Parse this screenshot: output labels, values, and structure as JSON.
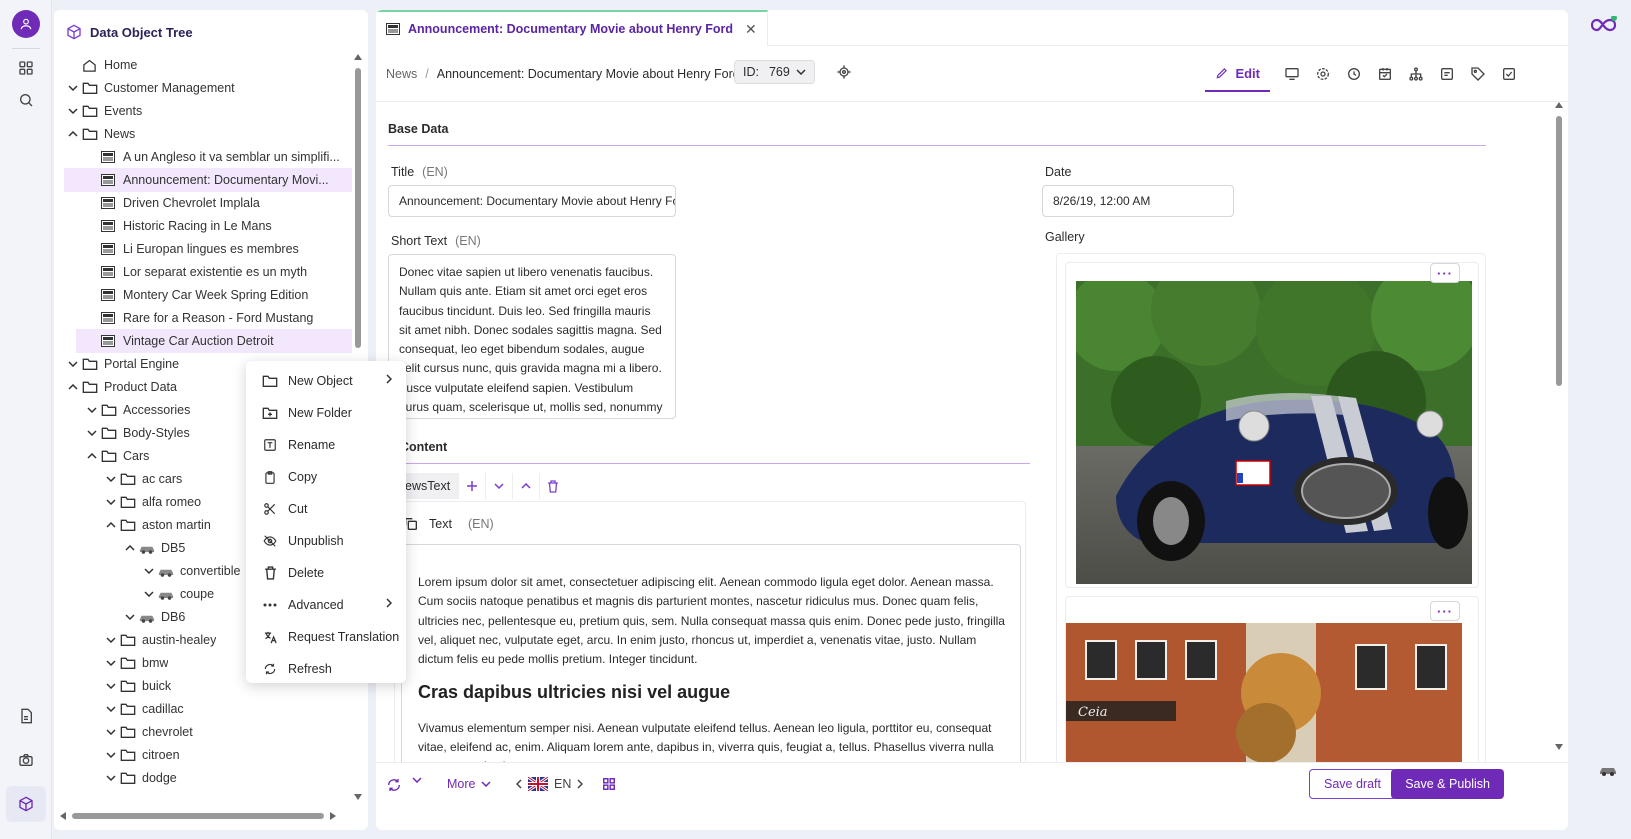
{
  "rail": {
    "icons": [
      "user-avatar-icon",
      "grid-icon",
      "search-icon",
      "document-icon",
      "camera-icon",
      "cube-icon"
    ]
  },
  "tree": {
    "title": "Data Object Tree",
    "items": [
      {
        "label": "Home",
        "level": 0,
        "chev": "none",
        "icon": "home"
      },
      {
        "label": "Customer Management",
        "level": 0,
        "chev": "down",
        "icon": "folder"
      },
      {
        "label": "Events",
        "level": 0,
        "chev": "down",
        "icon": "folder"
      },
      {
        "label": "News",
        "level": 0,
        "chev": "up",
        "icon": "folder"
      },
      {
        "label": "A un Angleso it va semblar un simplifi...",
        "level": 1,
        "chev": "none",
        "icon": "news"
      },
      {
        "label": "Announcement: Documentary Movi...",
        "level": 1,
        "chev": "none",
        "icon": "news",
        "selected": true
      },
      {
        "label": "Driven Chevrolet Implala",
        "level": 1,
        "chev": "none",
        "icon": "news"
      },
      {
        "label": "Historic Racing in Le Mans",
        "level": 1,
        "chev": "none",
        "icon": "news"
      },
      {
        "label": "Li Europan lingues es membres",
        "level": 1,
        "chev": "none",
        "icon": "news"
      },
      {
        "label": "Lor separat existentie es un myth",
        "level": 1,
        "chev": "none",
        "icon": "news"
      },
      {
        "label": "Montery Car Week Spring Edition",
        "level": 1,
        "chev": "none",
        "icon": "news"
      },
      {
        "label": "Rare for a Reason - Ford Mustang",
        "level": 1,
        "chev": "none",
        "icon": "news"
      },
      {
        "label": "Vintage Car Auction Detroit",
        "level": 1,
        "chev": "none",
        "icon": "news",
        "selected": true
      },
      {
        "label": "Portal Engine",
        "level": 0,
        "chev": "down",
        "icon": "folder"
      },
      {
        "label": "Product Data",
        "level": 0,
        "chev": "up",
        "icon": "folder"
      },
      {
        "label": "Accessories",
        "level": 1,
        "chev": "down",
        "icon": "folder"
      },
      {
        "label": "Body-Styles",
        "level": 1,
        "chev": "down",
        "icon": "folder"
      },
      {
        "label": "Cars",
        "level": 1,
        "chev": "up",
        "icon": "folder"
      },
      {
        "label": "ac cars",
        "level": 2,
        "chev": "down",
        "icon": "folder"
      },
      {
        "label": "alfa romeo",
        "level": 2,
        "chev": "down",
        "icon": "folder"
      },
      {
        "label": "aston martin",
        "level": 2,
        "chev": "up",
        "icon": "folder"
      },
      {
        "label": "DB5",
        "level": 3,
        "chev": "up",
        "icon": "car"
      },
      {
        "label": "convertible",
        "level": 4,
        "chev": "down",
        "icon": "car"
      },
      {
        "label": "coupe",
        "level": 4,
        "chev": "down",
        "icon": "car"
      },
      {
        "label": "DB6",
        "level": 3,
        "chev": "down",
        "icon": "car"
      },
      {
        "label": "austin-healey",
        "level": 2,
        "chev": "down",
        "icon": "folder"
      },
      {
        "label": "bmw",
        "level": 2,
        "chev": "down",
        "icon": "folder"
      },
      {
        "label": "buick",
        "level": 2,
        "chev": "down",
        "icon": "folder"
      },
      {
        "label": "cadillac",
        "level": 2,
        "chev": "down",
        "icon": "folder"
      },
      {
        "label": "chevrolet",
        "level": 2,
        "chev": "down",
        "icon": "folder"
      },
      {
        "label": "citroen",
        "level": 2,
        "chev": "down",
        "icon": "folder"
      },
      {
        "label": "dodge",
        "level": 2,
        "chev": "down",
        "icon": "folder"
      }
    ]
  },
  "context_menu": {
    "items": [
      {
        "label": "New Object",
        "icon": "folder-icon",
        "submenu": true
      },
      {
        "label": "New Folder",
        "icon": "folder-plus-icon",
        "submenu": false
      },
      {
        "label": "Rename",
        "icon": "rename-icon",
        "submenu": false
      },
      {
        "label": "Copy",
        "icon": "copy-icon",
        "submenu": false
      },
      {
        "label": "Cut",
        "icon": "scissors-icon",
        "submenu": false
      },
      {
        "label": "Unpublish",
        "icon": "eye-off-icon",
        "submenu": false
      },
      {
        "label": "Delete",
        "icon": "trash-icon",
        "submenu": false
      },
      {
        "label": "Advanced",
        "icon": "more-icon",
        "submenu": true
      },
      {
        "label": "Request Translation",
        "icon": "translate-icon",
        "submenu": false
      },
      {
        "label": "Refresh",
        "icon": "refresh-icon",
        "submenu": false
      }
    ]
  },
  "editor": {
    "tab_title": "Announcement: Documentary Movie about Henry Ford",
    "breadcrumb": {
      "parent": "News",
      "sep": "/",
      "current": "Announcement: Documentary Movie about Henry Ford"
    },
    "id_label": "ID:",
    "id_value": "769",
    "edit_label": "Edit",
    "base_data_title": "Base Data",
    "title_label": "Title",
    "title_lang": "(EN)",
    "title_value": "Announcement: Documentary Movie about Henry Ford",
    "date_label": "Date",
    "date_value": "8/26/19, 12:00 AM",
    "short_text_label": "Short Text",
    "short_text_lang": "(EN)",
    "short_text_value": "Donec vitae sapien ut libero venenatis faucibus. Nullam quis ante. Etiam sit amet orci eget eros faucibus tincidunt. Duis leo. Sed fringilla mauris sit amet nibh. Donec sodales sagittis magna. Sed consequat, leo eget bibendum sodales, augue velit cursus nunc, quis gravida magna mi a libero. Fusce vulputate eleifend sapien. Vestibulum purus quam, scelerisque ut, mollis sed, nonummy id, metus.",
    "gallery_label": "Gallery",
    "content_title": "Content",
    "block_type": "NewsText",
    "text_label": "Text",
    "text_lang": "(EN)",
    "text_p1": "Lorem ipsum dolor sit amet, consectetuer adipiscing elit. Aenean commodo ligula eget dolor. Aenean massa. Cum sociis natoque penatibus et magnis dis parturient montes, nascetur ridiculus mus. Donec quam felis, ultricies nec, pellentesque eu, pretium quis, sem. Nulla consequat massa quis enim. Donec pede justo, fringilla vel, aliquet nec, vulputate eget, arcu. In enim justo, rhoncus ut, imperdiet a, venenatis vitae, justo. Nullam dictum felis eu pede mollis pretium. Integer tincidunt.",
    "text_heading": "Cras dapibus ultricies nisi vel augue",
    "text_p2": "Vivamus elementum semper nisi. Aenean vulputate eleifend tellus. Aenean leo ligula, porttitor eu, consequat vitae, eleifend ac, enim. Aliquam lorem ante, dapibus in, viverra quis, feugiat a, tellus. Phasellus viverra nulla ut metus varius laoreet.",
    "image_menu": "···"
  },
  "bottom": {
    "more_label": "More",
    "lang_label": "EN",
    "save_draft": "Save draft",
    "save_publish": "Save & Publish"
  },
  "colors": {
    "accent": "#6f2ab8",
    "selection": "#f2e7fd",
    "tab_top": "#7ad3a4"
  }
}
